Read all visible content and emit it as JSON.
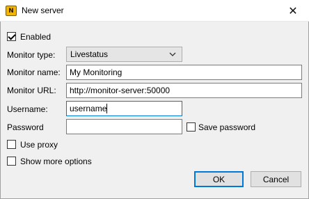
{
  "window": {
    "title": "New server",
    "app_icon": "nagstamon-icon",
    "close_glyph": "✕"
  },
  "form": {
    "enabled": {
      "label": "Enabled",
      "checked": true
    },
    "monitor_type": {
      "label": "Monitor type:",
      "value": "Livestatus"
    },
    "monitor_name": {
      "label": "Monitor name:",
      "value": "My Monitoring"
    },
    "monitor_url": {
      "label": "Monitor URL:",
      "value": "http://monitor-server:50000"
    },
    "username": {
      "label": "Username:",
      "value": "username"
    },
    "password": {
      "label": "Password",
      "value": ""
    },
    "save_password": {
      "label": "Save password",
      "checked": false
    },
    "use_proxy": {
      "label": "Use proxy",
      "checked": false
    },
    "show_more_options": {
      "label": "Show more options",
      "checked": false
    }
  },
  "buttons": {
    "ok": "OK",
    "cancel": "Cancel"
  }
}
